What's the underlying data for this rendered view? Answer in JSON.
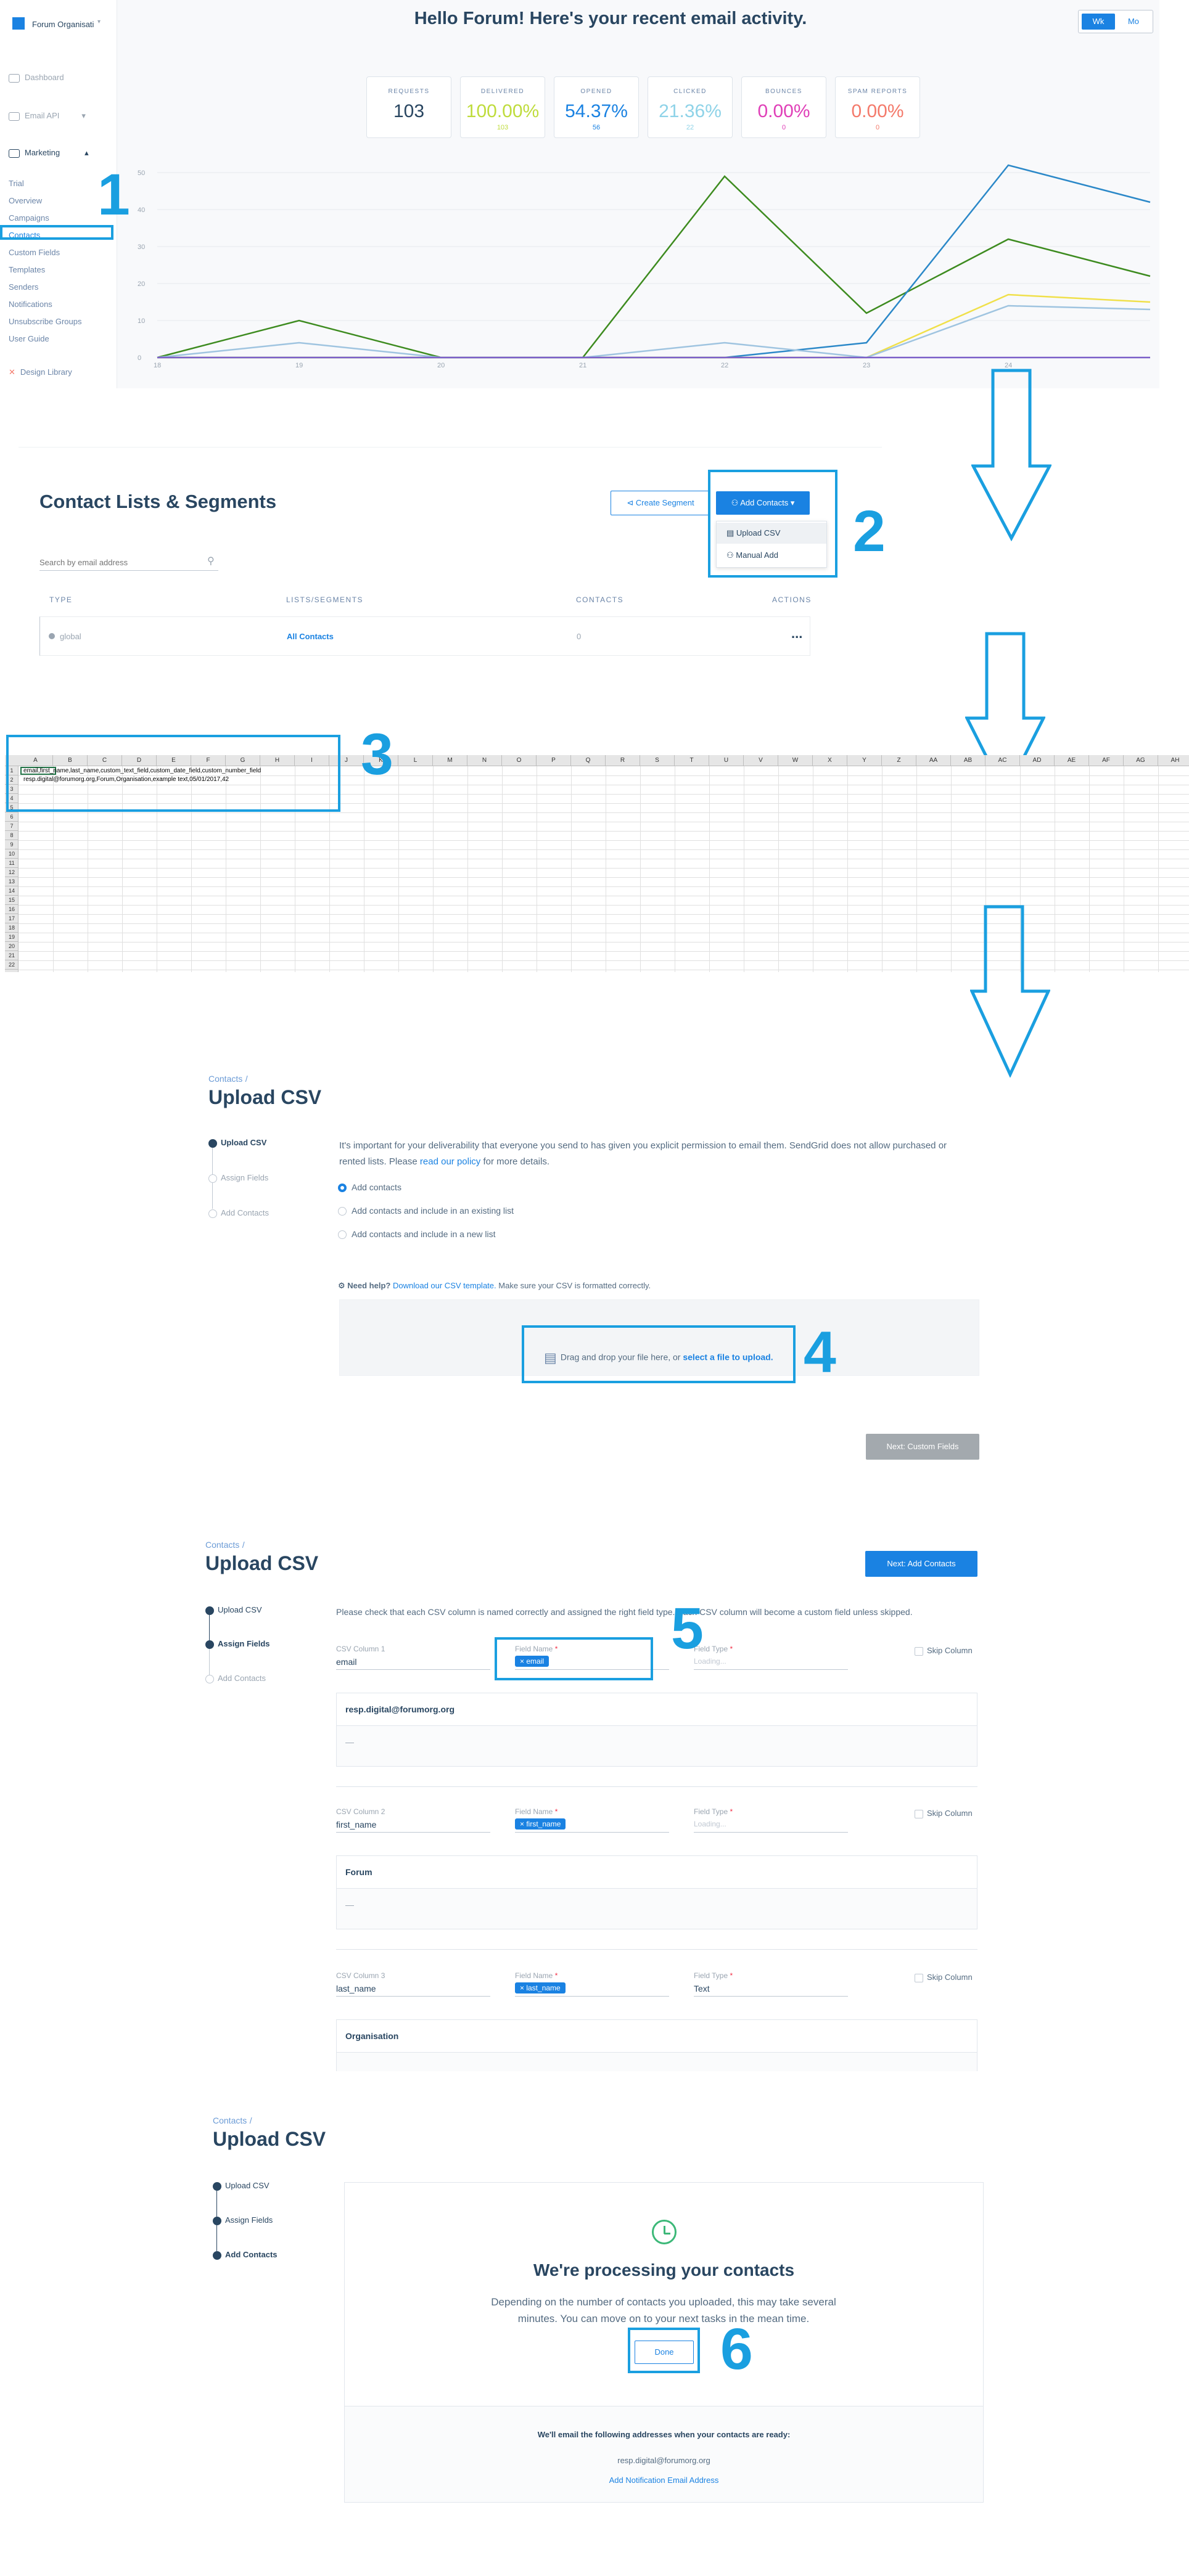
{
  "dashboard": {
    "account": "Forum Organisati",
    "greeting": "Hello Forum! Here's your recent email activity.",
    "toggle": [
      "Wk",
      "Mo"
    ],
    "sidebar": {
      "top_items": [
        "Dashboard",
        "Email API",
        "Marketing"
      ],
      "marketing_items": [
        "Trial",
        "Overview",
        "Campaigns",
        "Contacts",
        "Custom Fields",
        "Templates",
        "Senders",
        "Notifications",
        "Unsubscribe Groups",
        "User Guide"
      ],
      "bottom": "Design Library"
    },
    "stats": [
      {
        "label": "REQUESTS",
        "value": "103",
        "sub": "",
        "color": "#294661"
      },
      {
        "label": "DELIVERED",
        "value": "100.00%",
        "sub": "103",
        "color": "#bfdc3d"
      },
      {
        "label": "OPENED",
        "value": "54.37%",
        "sub": "56",
        "color": "#1a82e2"
      },
      {
        "label": "CLICKED",
        "value": "21.36%",
        "sub": "22",
        "color": "#8fd3e8"
      },
      {
        "label": "BOUNCES",
        "value": "0.00%",
        "sub": "0",
        "color": "#e040b8"
      },
      {
        "label": "SPAM REPORTS",
        "value": "0.00%",
        "sub": "0",
        "color": "#f47a6b"
      }
    ],
    "chart_data": {
      "type": "line",
      "x": [
        "18",
        "19",
        "20",
        "21",
        "22",
        "23",
        "24"
      ],
      "ylim": [
        0,
        50
      ],
      "yticks": [
        0,
        10,
        20,
        30,
        40,
        50
      ],
      "series": [
        {
          "color": "#3d8b1f",
          "values": [
            0,
            10,
            0,
            0,
            49,
            12,
            32,
            22
          ]
        },
        {
          "color": "#2b88c8",
          "values": [
            0,
            0,
            0,
            0,
            0,
            4,
            52,
            42
          ]
        },
        {
          "color": "#f0e04a",
          "values": [
            0,
            0,
            0,
            0,
            0,
            0,
            17,
            15
          ]
        },
        {
          "color": "#9fc4e0",
          "values": [
            0,
            4,
            0,
            0,
            4,
            0,
            14,
            13
          ]
        },
        {
          "color": "#7b5fc8",
          "values": [
            0,
            0,
            0,
            0,
            0,
            0,
            0,
            0
          ]
        }
      ]
    }
  },
  "contacts": {
    "title": "Contact Lists & Segments",
    "create_segment": "Create Segment",
    "add_contacts": "Add Contacts",
    "menu": [
      "Upload CSV",
      "Manual Add"
    ],
    "search_placeholder": "Search by email address",
    "columns": [
      "TYPE",
      "LISTS/SEGMENTS",
      "CONTACTS",
      "ACTIONS"
    ],
    "row": {
      "type": "global",
      "name": "All Contacts",
      "count": "0",
      "actions": "..."
    }
  },
  "sheet": {
    "columns": [
      "A",
      "B",
      "C",
      "D",
      "E",
      "F",
      "G",
      "H",
      "I",
      "J",
      "K",
      "L",
      "M",
      "N",
      "O",
      "P",
      "Q",
      "R",
      "S",
      "T",
      "U",
      "V",
      "W",
      "X",
      "Y",
      "Z",
      "AA",
      "AB",
      "AC",
      "AD",
      "AE",
      "AF",
      "AG",
      "AH"
    ],
    "rows": 22,
    "cell_a1": "email",
    "row1": "email,first_name,last_name,custom_text_field,custom_date_field,custom_number_field",
    "row2": "resp.digital@forumorg.org,Forum,Organisation,example text,05/01/2017,42"
  },
  "upload1": {
    "crumb": "Contacts",
    "slash": "/",
    "title": "Upload CSV",
    "steps": [
      "Upload CSV",
      "Assign Fields",
      "Add Contacts"
    ],
    "intro_a": "It's important for your deliverability that everyone you send to has given you explicit permission to email them. SendGrid does not allow purchased or rented lists. Please ",
    "intro_link": "read our policy",
    "intro_b": " for more details.",
    "options": [
      "Add contacts",
      "Add contacts and include in an existing list",
      "Add contacts and include in a new list"
    ],
    "help_bold": "Need help?",
    "help_link": "Download our CSV template.",
    "help_rest": "Make sure your CSV is formatted correctly.",
    "drop_a": "Drag and drop your file here, or ",
    "drop_link": "select a file to upload.",
    "next": "Next: Custom Fields"
  },
  "upload2": {
    "crumb": "Contacts",
    "slash": "/",
    "title": "Upload CSV",
    "next": "Next: Add Contacts",
    "steps": [
      "Upload CSV",
      "Assign Fields",
      "Add Contacts"
    ],
    "intro": "Please check that each CSV column is named correctly and assigned the right field type. Each CSV column will become a custom field unless skipped.",
    "field_name_label": "Field Name",
    "field_type_label": "Field Type",
    "asterisk": "*",
    "skip": "Skip Column",
    "columns": [
      {
        "label": "CSV Column 1",
        "value": "email",
        "chip": "email",
        "type": "Loading...",
        "preview_head": "resp.digital@forumorg.org",
        "preview_body": "—"
      },
      {
        "label": "CSV Column 2",
        "value": "first_name",
        "chip": "first_name",
        "type": "Loading...",
        "preview_head": "Forum",
        "preview_body": "—"
      },
      {
        "label": "CSV Column 3",
        "value": "last_name",
        "chip": "last_name",
        "type": "Text",
        "preview_head": "Organisation",
        "preview_body": ""
      }
    ]
  },
  "upload3": {
    "crumb": "Contacts",
    "slash": "/",
    "title": "Upload CSV",
    "steps": [
      "Upload CSV",
      "Assign Fields",
      "Add Contacts"
    ],
    "heading": "We're processing your contacts",
    "body": "Depending on the number of contacts you uploaded, this may take several minutes. You can move on to your next tasks in the mean time.",
    "done": "Done",
    "notify_title": "We'll email the following addresses when your contacts are ready:",
    "notify_email": "resp.digital@forumorg.org",
    "notify_link": "Add Notification Email Address"
  },
  "annotations": [
    "1",
    "2",
    "3",
    "4",
    "5",
    "6"
  ]
}
